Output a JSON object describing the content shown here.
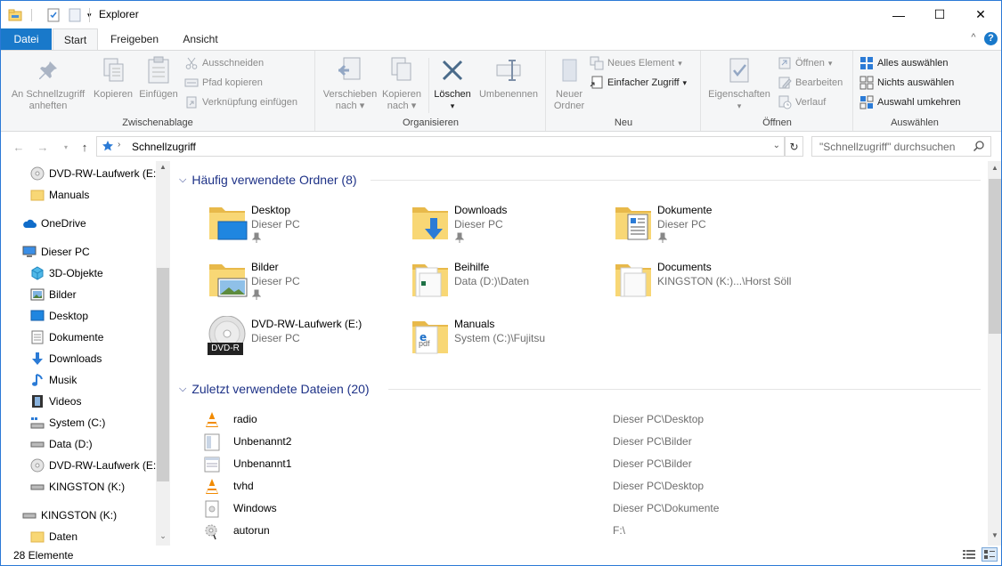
{
  "window": {
    "title": "Explorer",
    "minimize_glyph": "—",
    "maximize_glyph": "☐",
    "close_glyph": "✕"
  },
  "tabs": [
    "Datei",
    "Start",
    "Freigeben",
    "Ansicht"
  ],
  "ribbon": {
    "clipboard": {
      "label": "Zwischenablage",
      "pin_line1": "An Schnellzugriff",
      "pin_line2": "anheften",
      "copy": "Kopieren",
      "paste": "Einfügen",
      "cut": "Ausschneiden",
      "copy_path": "Pfad kopieren",
      "paste_shortcut": "Verknüpfung einfügen"
    },
    "organize": {
      "label": "Organisieren",
      "move_line1": "Verschieben",
      "move_line2": "nach",
      "copyto_line1": "Kopieren",
      "copyto_line2": "nach",
      "delete": "Löschen",
      "rename": "Umbenennen"
    },
    "new": {
      "label": "Neu",
      "folder_line1": "Neuer",
      "folder_line2": "Ordner",
      "new_item": "Neues Element",
      "easy_access": "Einfacher Zugriff"
    },
    "open": {
      "label": "Öffnen",
      "properties": "Eigenschaften",
      "open": "Öffnen",
      "edit": "Bearbeiten",
      "history": "Verlauf"
    },
    "select": {
      "label": "Auswählen",
      "select_all": "Alles auswählen",
      "select_none": "Nichts auswählen",
      "invert": "Auswahl umkehren"
    }
  },
  "address": {
    "path": "Schnellzugriff",
    "search_placeholder": "\"Schnellzugriff\" durchsuchen"
  },
  "nav": {
    "items": [
      {
        "label": "DVD-RW-Laufwerk (E:)",
        "icon": "dvd-icon"
      },
      {
        "label": "Manuals",
        "icon": "folder-icon"
      },
      {
        "label": "OneDrive",
        "icon": "cloud-icon"
      },
      {
        "label": "Dieser PC",
        "icon": "computer-icon"
      },
      {
        "label": "3D-Objekte",
        "icon": "cube-icon"
      },
      {
        "label": "Bilder",
        "icon": "pictures-icon"
      },
      {
        "label": "Desktop",
        "icon": "desktop-icon"
      },
      {
        "label": "Dokumente",
        "icon": "documents-icon"
      },
      {
        "label": "Downloads",
        "icon": "download-icon"
      },
      {
        "label": "Musik",
        "icon": "music-icon"
      },
      {
        "label": "Videos",
        "icon": "video-icon"
      },
      {
        "label": "System (C:)",
        "icon": "drive-icon"
      },
      {
        "label": "Data (D:)",
        "icon": "drive-icon"
      },
      {
        "label": "DVD-RW-Laufwerk (E:)",
        "icon": "dvd-icon"
      },
      {
        "label": "KINGSTON (K:)",
        "icon": "usb-drive-icon"
      },
      {
        "label": "KINGSTON (K:)",
        "icon": "usb-drive-icon"
      },
      {
        "label": "Daten",
        "icon": "folder-icon"
      }
    ]
  },
  "frequent": {
    "header": "Häufig verwendete Ordner (8)",
    "tiles": [
      {
        "name": "Desktop",
        "sub": "Dieser PC"
      },
      {
        "name": "Downloads",
        "sub": "Dieser PC"
      },
      {
        "name": "Dokumente",
        "sub": "Dieser PC"
      },
      {
        "name": "Bilder",
        "sub": "Dieser PC"
      },
      {
        "name": "Beihilfe",
        "sub": "Data (D:)\\Daten"
      },
      {
        "name": "Documents",
        "sub": "KINGSTON (K:)...\\Horst Söll"
      },
      {
        "name": "DVD-RW-Laufwerk (E:)",
        "sub": "Dieser PC"
      },
      {
        "name": "Manuals",
        "sub": "System (C:)\\Fujitsu"
      }
    ],
    "dvd_badge": "DVD-R",
    "pdf_badge": "pdf"
  },
  "recent": {
    "header": "Zuletzt verwendete Dateien (20)",
    "files": [
      {
        "name": "radio",
        "path": "Dieser PC\\Desktop"
      },
      {
        "name": "Unbenannt2",
        "path": "Dieser PC\\Bilder"
      },
      {
        "name": "Unbenannt1",
        "path": "Dieser PC\\Bilder"
      },
      {
        "name": "tvhd",
        "path": "Dieser PC\\Desktop"
      },
      {
        "name": "Windows",
        "path": "Dieser PC\\Dokumente"
      },
      {
        "name": "autorun",
        "path": "F:\\"
      }
    ]
  },
  "status": {
    "count": "28 Elemente"
  },
  "colors": {
    "accent": "#1979ca",
    "folder": "#f8d775",
    "section_header": "#1e3287"
  }
}
